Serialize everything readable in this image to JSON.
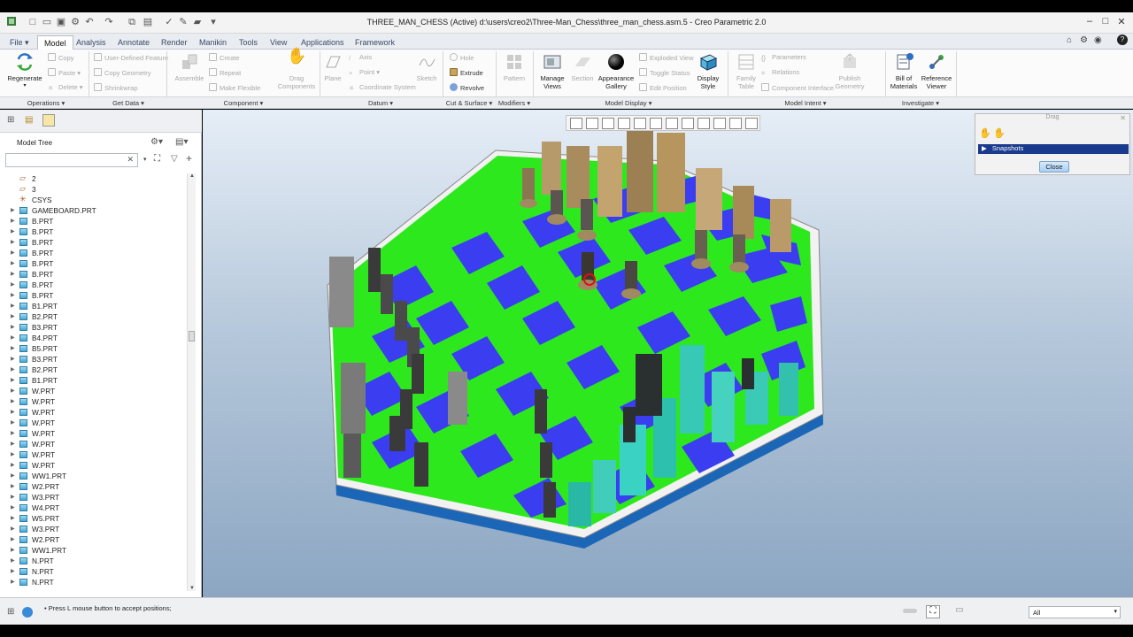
{
  "window": {
    "title": "THREE_MAN_CHESS (Active) d:\\users\\creo2\\Three-Man_Chess\\three_man_chess.asm.5 - Creo Parametric 2.0",
    "help_icon": "?"
  },
  "tabs": [
    "File",
    "Model",
    "Analysis",
    "Annotate",
    "Render",
    "Manikin",
    "Tools",
    "View",
    "Applications",
    "Framework"
  ],
  "ribbon": {
    "operations": {
      "regenerate": "Regenerate",
      "copy": "Copy",
      "paste": "Paste",
      "delete": "Delete"
    },
    "get_data": {
      "udf": "User-Defined Feature",
      "copy_geometry": "Copy Geometry",
      "shrinkwrap": "Shrinkwrap"
    },
    "component": {
      "assemble": "Assemble",
      "create": "Create",
      "repeat": "Repeat",
      "make_flexible": "Make Flexible",
      "drag": "Drag Components"
    },
    "datum": {
      "plane": "Plane",
      "axis": "Axis",
      "point": "Point",
      "csys": "Coordinate System",
      "sketch": "Sketch"
    },
    "cut_surface": {
      "hole": "Hole",
      "extrude": "Extrude",
      "revolve": "Revolve"
    },
    "modifiers": {
      "pattern": "Pattern"
    },
    "model_display": {
      "manage_views": "Manage Views",
      "section": "Section",
      "appearance": "Appearance Gallery",
      "exploded": "Exploded View",
      "toggle_status": "Toggle Status",
      "edit_position": "Edit Position",
      "display_style": "Display Style"
    },
    "model_intent": {
      "family_table": "Family Table",
      "parameters": "Parameters",
      "relations": "Relations",
      "component_interface": "Component Interface",
      "publish": "Publish Geometry"
    },
    "investigate": {
      "bom": "Bill of Materials",
      "reference_viewer": "Reference Viewer"
    },
    "groups": [
      "Operations",
      "Get Data",
      "Component",
      "Datum",
      "Cut & Surface",
      "Modifiers",
      "Model Display",
      "Model Intent",
      "Investigate"
    ]
  },
  "model_tree": {
    "title": "Model Tree",
    "items": [
      {
        "label": "2",
        "kind": "datum",
        "expandable": false
      },
      {
        "label": "3",
        "kind": "datum",
        "expandable": false
      },
      {
        "label": "CSYS",
        "kind": "csys",
        "expandable": false
      },
      {
        "label": "GAMEBOARD.PRT",
        "kind": "part",
        "expandable": true
      },
      {
        "label": "B.PRT",
        "kind": "part",
        "expandable": true
      },
      {
        "label": "B.PRT",
        "kind": "part",
        "expandable": true
      },
      {
        "label": "B.PRT",
        "kind": "part",
        "expandable": true
      },
      {
        "label": "B.PRT",
        "kind": "part",
        "expandable": true
      },
      {
        "label": "B.PRT",
        "kind": "part",
        "expandable": true
      },
      {
        "label": "B.PRT",
        "kind": "part",
        "expandable": true
      },
      {
        "label": "B.PRT",
        "kind": "part",
        "expandable": true
      },
      {
        "label": "B.PRT",
        "kind": "part",
        "expandable": true
      },
      {
        "label": "B1.PRT",
        "kind": "part",
        "expandable": true
      },
      {
        "label": "B2.PRT",
        "kind": "part",
        "expandable": true
      },
      {
        "label": "B3.PRT",
        "kind": "part",
        "expandable": true
      },
      {
        "label": "B4.PRT",
        "kind": "part",
        "expandable": true
      },
      {
        "label": "B5.PRT",
        "kind": "part",
        "expandable": true
      },
      {
        "label": "B3.PRT",
        "kind": "part",
        "expandable": true
      },
      {
        "label": "B2.PRT",
        "kind": "part",
        "expandable": true
      },
      {
        "label": "B1.PRT",
        "kind": "part",
        "expandable": true
      },
      {
        "label": "W.PRT",
        "kind": "part",
        "expandable": true
      },
      {
        "label": "W.PRT",
        "kind": "part",
        "expandable": true
      },
      {
        "label": "W.PRT",
        "kind": "part",
        "expandable": true
      },
      {
        "label": "W.PRT",
        "kind": "part",
        "expandable": true
      },
      {
        "label": "W.PRT",
        "kind": "part",
        "expandable": true
      },
      {
        "label": "W.PRT",
        "kind": "part",
        "expandable": true
      },
      {
        "label": "W.PRT",
        "kind": "part",
        "expandable": true
      },
      {
        "label": "W.PRT",
        "kind": "part",
        "expandable": true
      },
      {
        "label": "WW1.PRT",
        "kind": "part",
        "expandable": true
      },
      {
        "label": "W2.PRT",
        "kind": "part",
        "expandable": true
      },
      {
        "label": "W3.PRT",
        "kind": "part",
        "expandable": true
      },
      {
        "label": "W4.PRT",
        "kind": "part",
        "expandable": true
      },
      {
        "label": "W5.PRT",
        "kind": "part",
        "expandable": true
      },
      {
        "label": "W3.PRT",
        "kind": "part",
        "expandable": true
      },
      {
        "label": "W2.PRT",
        "kind": "part",
        "expandable": true
      },
      {
        "label": "WW1.PRT",
        "kind": "part",
        "expandable": true
      },
      {
        "label": "N.PRT",
        "kind": "part",
        "expandable": true
      },
      {
        "label": "N.PRT",
        "kind": "part",
        "expandable": true
      },
      {
        "label": "N.PRT",
        "kind": "part",
        "expandable": true
      }
    ]
  },
  "drag_panel": {
    "title": "Drag",
    "snapshots": "Snapshots",
    "close": "Close"
  },
  "status": {
    "message": "Press L mouse button to accept positions;",
    "filter": "All"
  },
  "colors": {
    "board_green": "#2ee81e",
    "board_blue": "#3a3ef0",
    "accent": "#1a3a8e"
  }
}
